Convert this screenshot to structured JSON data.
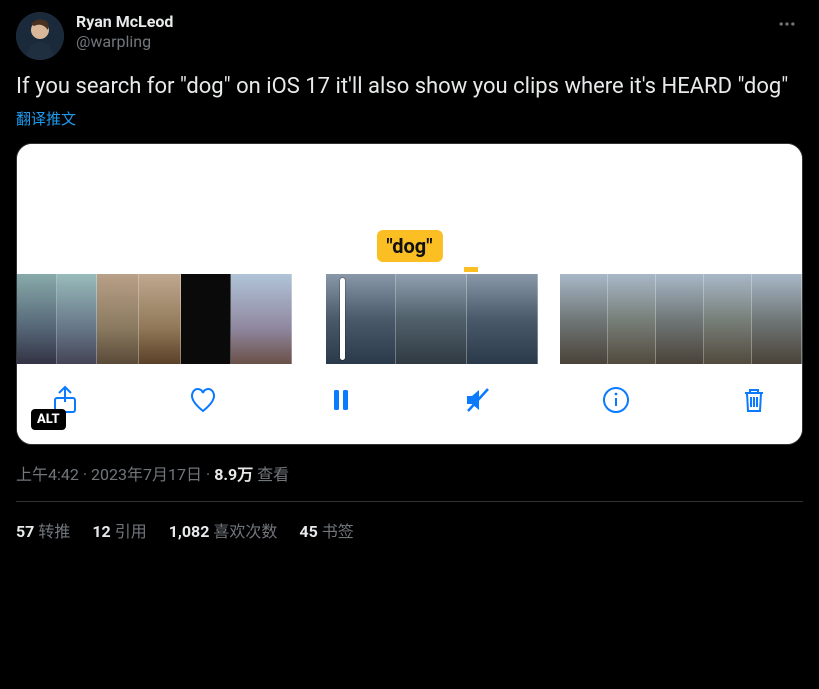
{
  "author": {
    "display_name": "Ryan McLeod",
    "handle": "@warpling"
  },
  "tweet_text": "If you search for \"dog\" on iOS 17 it'll also show you clips where it's HEARD \"dog\"",
  "translate_label": "翻译推文",
  "media": {
    "search_term": "\"dog\"",
    "alt_badge": "ALT"
  },
  "meta": {
    "time": "上午4:42",
    "date": "2023年7月17日",
    "views_count": "8.9万",
    "views_label": "查看"
  },
  "stats": {
    "retweets_count": "57",
    "retweets_label": "转推",
    "quotes_count": "12",
    "quotes_label": "引用",
    "likes_count": "1,082",
    "likes_label": "喜欢次数",
    "bookmarks_count": "45",
    "bookmarks_label": "书签"
  }
}
